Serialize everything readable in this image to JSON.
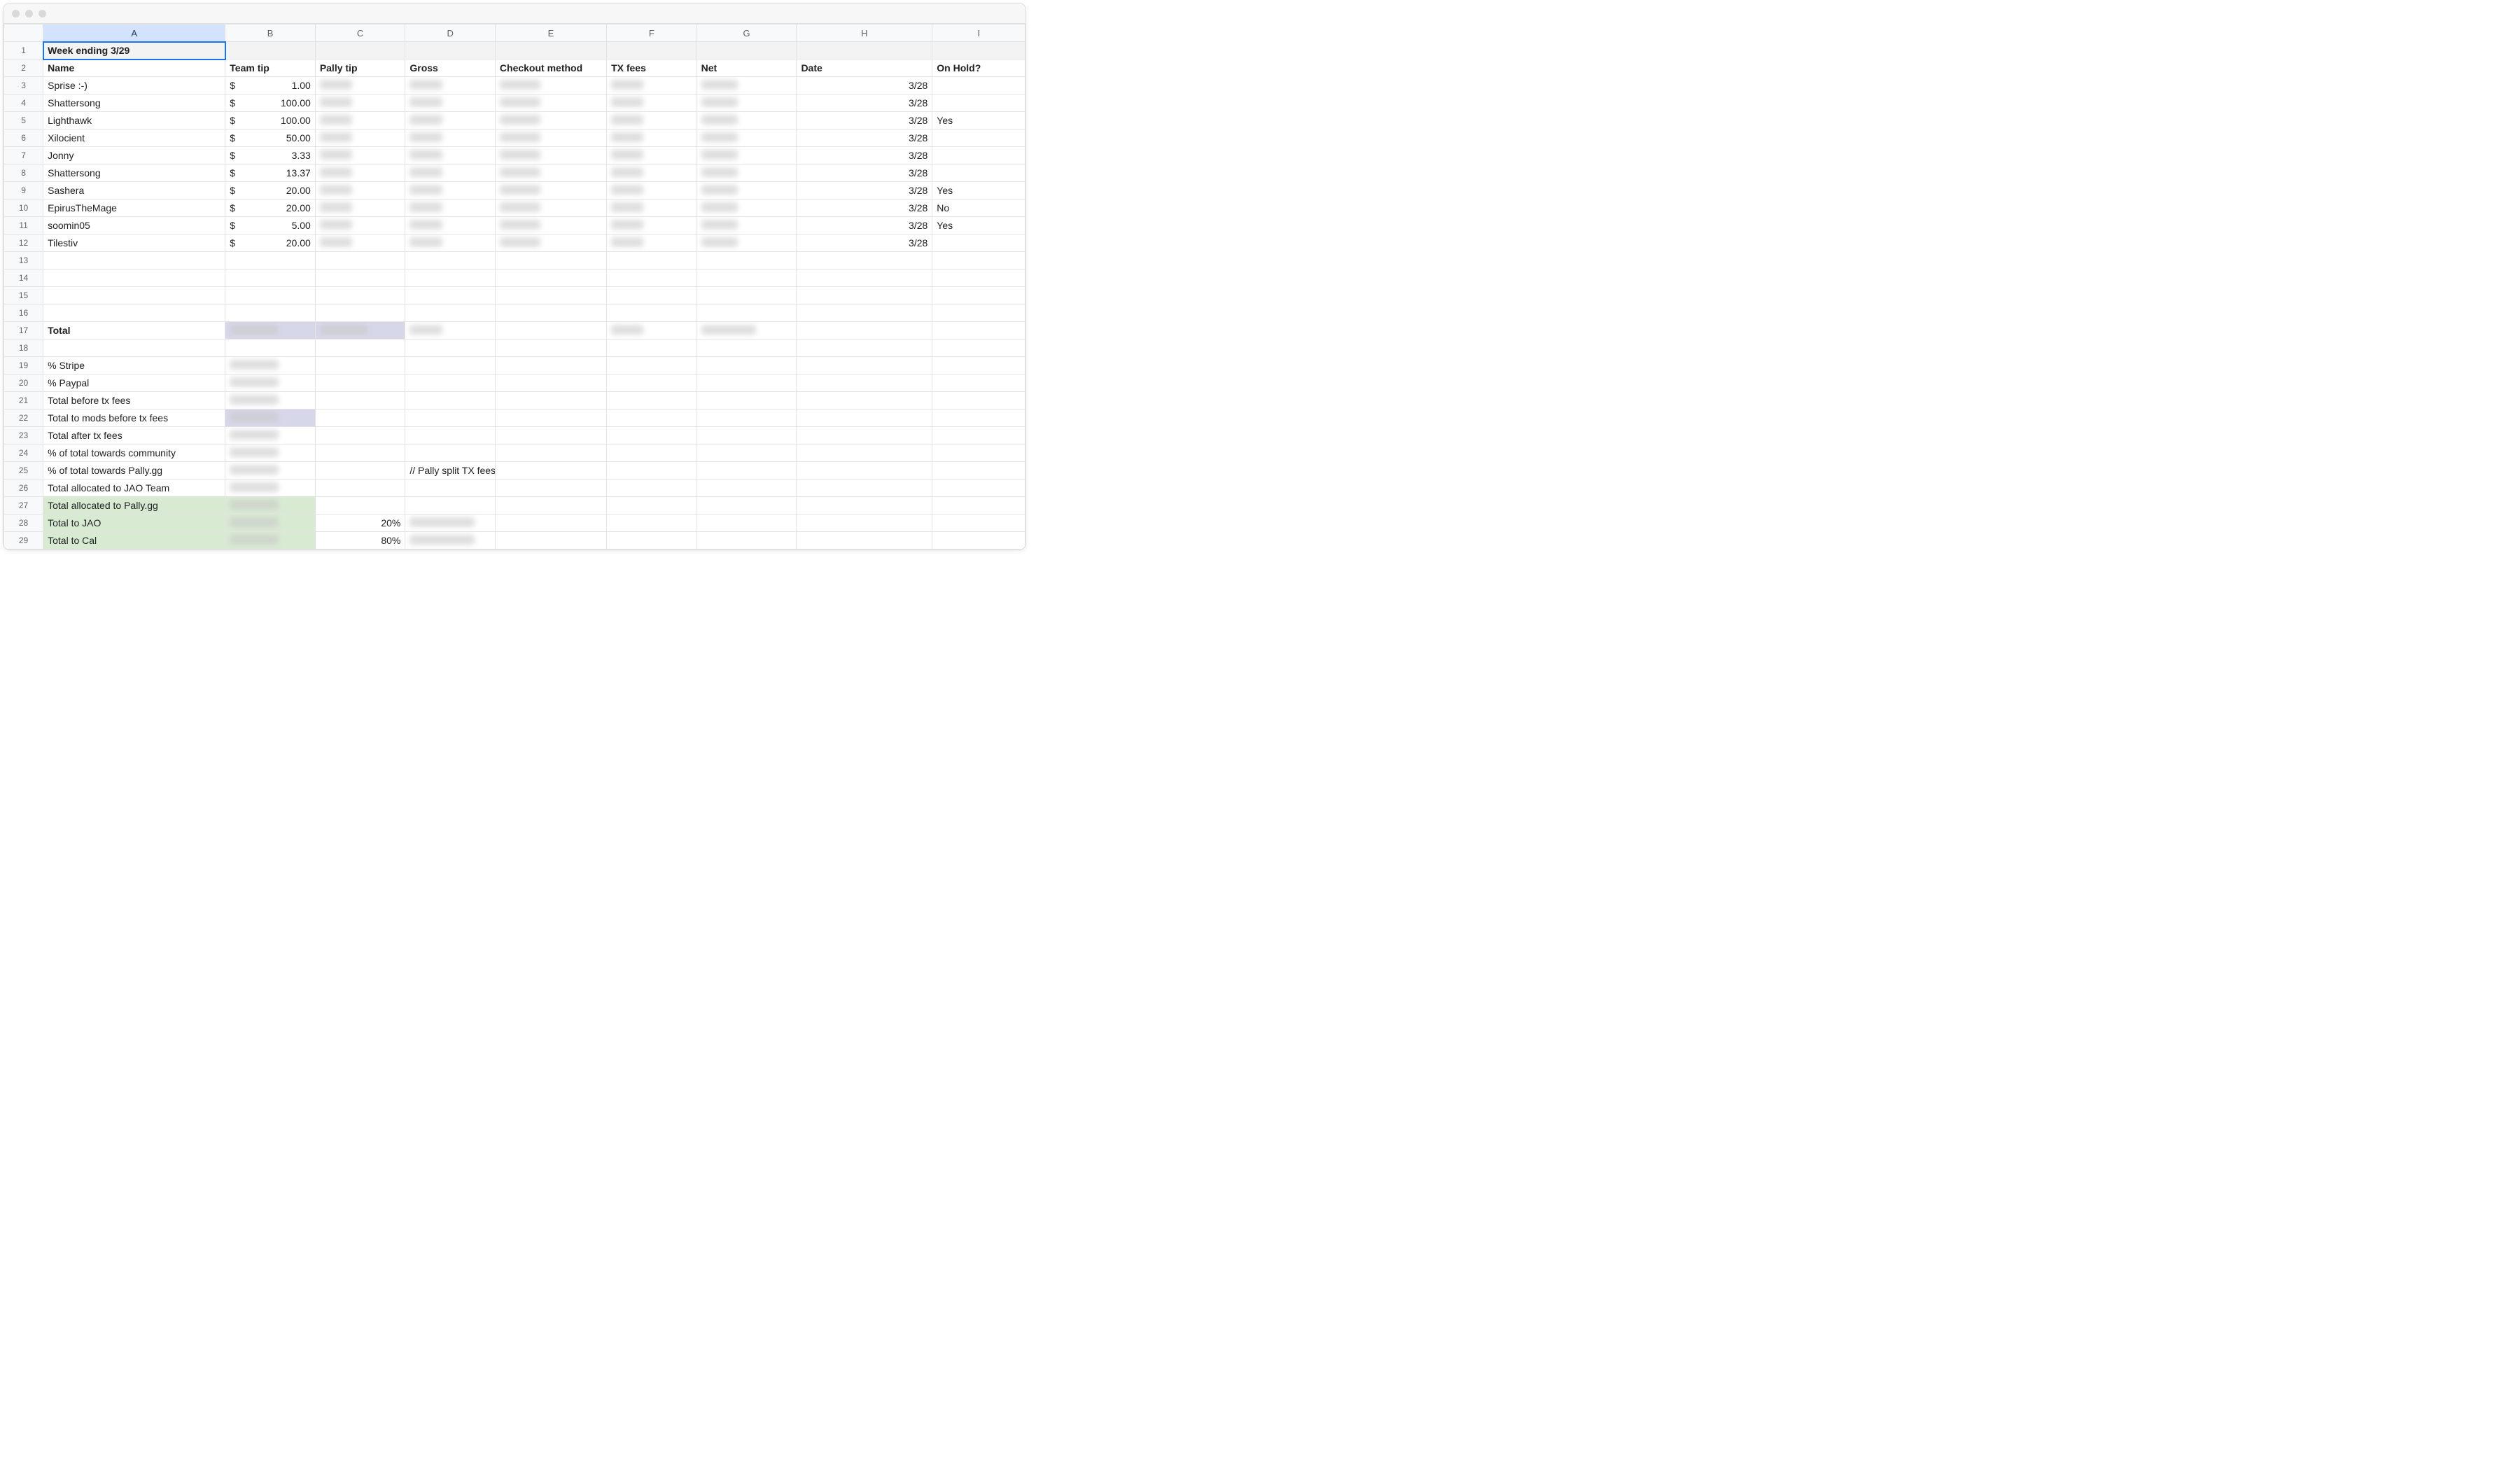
{
  "columns": [
    "A",
    "B",
    "C",
    "D",
    "E",
    "F",
    "G",
    "H",
    "I"
  ],
  "title_row": {
    "A": "Week ending 3/29"
  },
  "header_row": {
    "A": "Name",
    "B": "Team tip",
    "C": "Pally tip",
    "D": "Gross",
    "E": "Checkout method",
    "F": "TX fees",
    "G": "Net",
    "H": "Date",
    "I": "On Hold?"
  },
  "data_rows": [
    {
      "name": "Sprise :-)",
      "team_tip": "1.00",
      "date": "3/28",
      "on_hold": ""
    },
    {
      "name": "Shattersong",
      "team_tip": "100.00",
      "date": "3/28",
      "on_hold": ""
    },
    {
      "name": "Lighthawk",
      "team_tip": "100.00",
      "date": "3/28",
      "on_hold": "Yes"
    },
    {
      "name": "Xilocient",
      "team_tip": "50.00",
      "date": "3/28",
      "on_hold": ""
    },
    {
      "name": "Jonny",
      "team_tip": "3.33",
      "date": "3/28",
      "on_hold": ""
    },
    {
      "name": "Shattersong",
      "team_tip": "13.37",
      "date": "3/28",
      "on_hold": ""
    },
    {
      "name": "Sashera",
      "team_tip": "20.00",
      "date": "3/28",
      "on_hold": "Yes"
    },
    {
      "name": "EpirusTheMage",
      "team_tip": "20.00",
      "date": "3/28",
      "on_hold": "No"
    },
    {
      "name": "soomin05",
      "team_tip": "5.00",
      "date": "3/28",
      "on_hold": "Yes"
    },
    {
      "name": "Tilestiv",
      "team_tip": "20.00",
      "date": "3/28",
      "on_hold": ""
    }
  ],
  "currency_symbol": "$",
  "total_label": "Total",
  "summary_rows": [
    {
      "row": 19,
      "label": "% Stripe"
    },
    {
      "row": 20,
      "label": "% Paypal"
    },
    {
      "row": 21,
      "label": "Total before tx fees"
    },
    {
      "row": 22,
      "label": "Total to mods before tx fees"
    },
    {
      "row": 23,
      "label": "Total after tx fees"
    },
    {
      "row": 24,
      "label": "% of total towards community"
    },
    {
      "row": 25,
      "label": "% of total towards Pally.gg",
      "d_note": "// Pally split TX fees with streamer"
    },
    {
      "row": 26,
      "label": "Total allocated to JAO Team"
    },
    {
      "row": 27,
      "label": "Total allocated to Pally.gg",
      "green": true
    },
    {
      "row": 28,
      "label": "Total to JAO",
      "c_value": "20%",
      "green": true
    },
    {
      "row": 29,
      "label": "Total to Cal",
      "c_value": "80%",
      "green": true
    }
  ]
}
